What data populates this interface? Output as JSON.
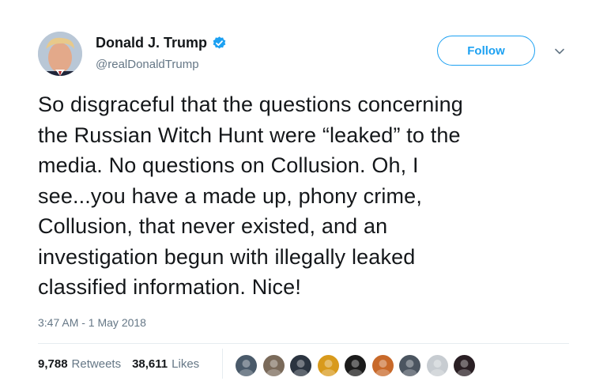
{
  "author": {
    "display_name": "Donald J. Trump",
    "handle": "@realDonaldTrump",
    "verified_icon": "verified-badge-icon",
    "verified_color": "#1da1f2"
  },
  "follow_label": "Follow",
  "tweet": {
    "text": "So disgraceful that the questions concerning\nthe Russian Witch Hunt were “leaked” to the\nmedia. No questions on Collusion. Oh, I\nsee...you have a made up, phony crime,\nCollusion, that never existed, and an\ninvestigation begun with illegally leaked\nclassified information. Nice!",
    "timestamp": "3:47 AM - 1 May 2018"
  },
  "stats": {
    "retweets_count": "9,788",
    "retweets_label": "Retweets",
    "likes_count": "38,611",
    "likes_label": "Likes"
  },
  "likers": [
    {
      "icon": "liker-avatar-icon",
      "color": "#4a5a6a"
    },
    {
      "icon": "liker-avatar-icon",
      "color": "#7a6a5a"
    },
    {
      "icon": "liker-avatar-icon",
      "color": "#2b3440"
    },
    {
      "icon": "liker-avatar-icon",
      "color": "#d89a1c"
    },
    {
      "icon": "liker-avatar-icon",
      "color": "#1b1b1b"
    },
    {
      "icon": "liker-avatar-icon",
      "color": "#c8692a"
    },
    {
      "icon": "liker-avatar-icon",
      "color": "#4b5560"
    },
    {
      "icon": "liker-avatar-icon",
      "color": "#c7ccd1"
    },
    {
      "icon": "liker-avatar-icon",
      "color": "#2a1f24"
    }
  ],
  "colors": {
    "accent": "#1da1f2",
    "secondary_text": "#657786",
    "primary_text": "#14171a"
  }
}
